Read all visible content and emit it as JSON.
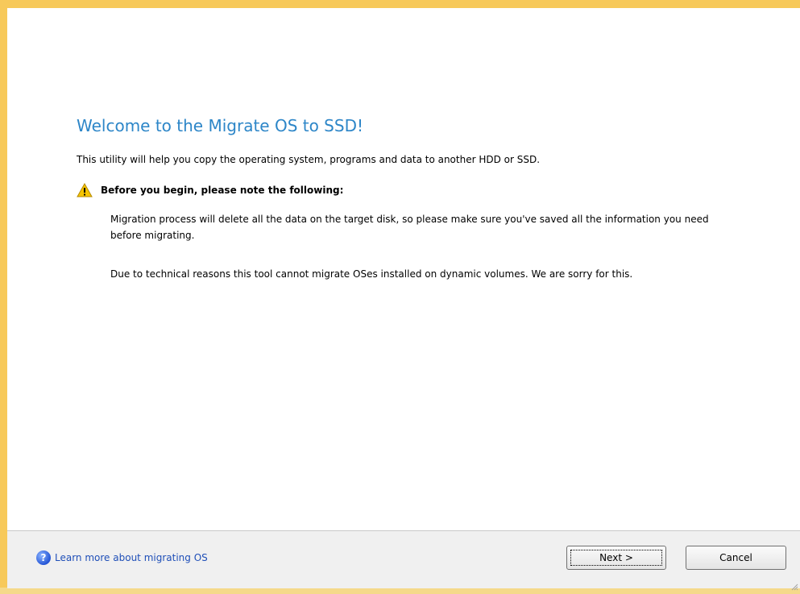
{
  "title": "Welcome to the Migrate OS to SSD!",
  "intro": "This utility will help you copy the operating system, programs and data to another HDD or SSD.",
  "warning": {
    "heading": "Before you begin, please note the following:",
    "icon": "warning-icon"
  },
  "notes": [
    "Migration process will delete all the data on the target disk, so please make sure you've saved all the information you need before migrating.",
    "Due to technical reasons this tool cannot migrate OSes installed on dynamic volumes. We are sorry for this."
  ],
  "footer": {
    "help_link": "Learn more about migrating OS",
    "help_icon": "help-icon",
    "next_label": "Next >",
    "cancel_label": "Cancel"
  },
  "colors": {
    "title": "#2d86c8",
    "link": "#1f4fb8",
    "frame": "#f7c95a",
    "footer_bg": "#f0f0f0"
  }
}
